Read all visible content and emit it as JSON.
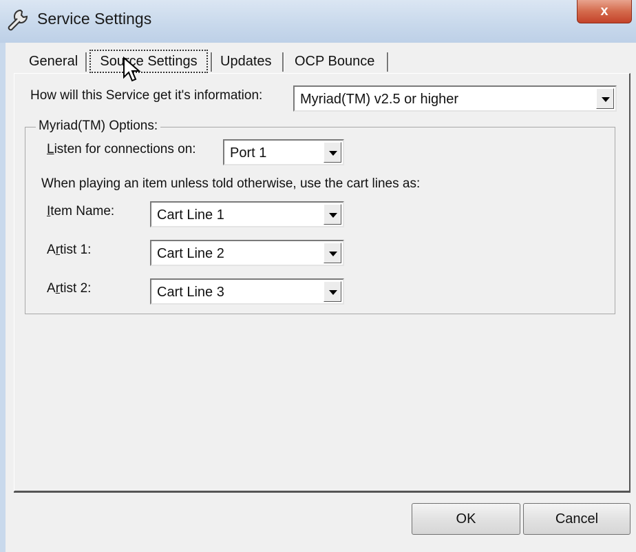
{
  "window": {
    "title": "Service Settings",
    "close_glyph": "x",
    "icon": "wrench-icon"
  },
  "tabs": [
    {
      "label": "General",
      "active": false
    },
    {
      "label": "Source Settings",
      "active": true
    },
    {
      "label": "Updates",
      "active": false
    },
    {
      "label": "OCP Bounce",
      "active": false
    }
  ],
  "source": {
    "question_label": "How will this Service get it's information:",
    "source_value": "Myriad(TM) v2.5 or higher"
  },
  "myriad_options": {
    "group_title": "Myriad(TM) Options:",
    "listen_label_first": "L",
    "listen_label_rest": "isten for connections on:",
    "port_value": "Port 1",
    "cart_hint": "When playing an item unless told otherwise, use the cart lines as:",
    "item_name_first": "I",
    "item_name_rest": "tem Name:",
    "item_name_value": "Cart Line 1",
    "artist1_first": "A",
    "artist1_mid": "r",
    "artist1_rest": "tist 1:",
    "artist1_value": "Cart Line 2",
    "artist2_first": "A",
    "artist2_mid": "r",
    "artist2_rest": "tist 2:",
    "artist2_value": "Cart Line 3"
  },
  "buttons": {
    "ok_label": "OK",
    "cancel_label": "Cancel"
  },
  "colors": {
    "titlebar": "#c9d9ec",
    "close_button": "#c4432a",
    "dialog_face": "#f0f0f0"
  }
}
